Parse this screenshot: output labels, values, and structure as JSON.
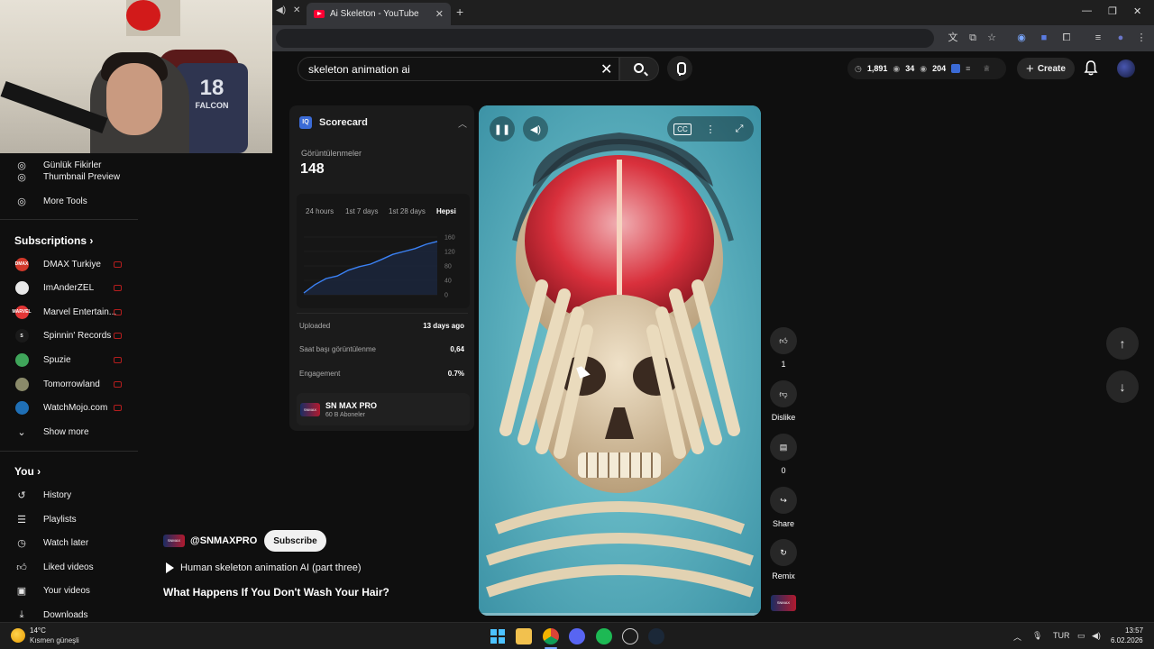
{
  "browser": {
    "tab_title": "Ai Skeleton - YouTube",
    "tab_close": "✕",
    "new_tab": "+"
  },
  "search": {
    "query": "skeleton animation ai"
  },
  "header_stats": {
    "stat1": "1,891",
    "stat2": "34",
    "stat3": "204"
  },
  "header": {
    "create_label": "Create"
  },
  "webcam": {
    "jersey_number": "18",
    "jersey_text": "FALCON"
  },
  "sidebar": {
    "top_items": [
      {
        "label": "Günlük Fikirler"
      },
      {
        "label": "Thumbnail Preview"
      },
      {
        "label": "More Tools"
      }
    ],
    "subscriptions_title": "Subscriptions",
    "subscriptions": [
      {
        "label": "DMAX Turkiye",
        "avatar_text": "DMAX",
        "avatar_color": "#d1382a"
      },
      {
        "label": "ImAnderZEL",
        "avatar_text": "",
        "avatar_color": "#e8e8e8"
      },
      {
        "label": "Marvel Entertain...",
        "avatar_text": "MARVEL",
        "avatar_color": "#e23636"
      },
      {
        "label": "Spinnin' Records",
        "avatar_text": "S",
        "avatar_color": "#1a1a1a"
      },
      {
        "label": "Spuzie",
        "avatar_text": "",
        "avatar_color": "#3fa55a"
      },
      {
        "label": "Tomorrowland",
        "avatar_text": "",
        "avatar_color": "#8a8a6a"
      },
      {
        "label": "WatchMojo.com",
        "avatar_text": "",
        "avatar_color": "#1f6fb5"
      }
    ],
    "show_more": "Show more",
    "you_title": "You",
    "you_items": [
      {
        "label": "History"
      },
      {
        "label": "Playlists"
      },
      {
        "label": "Watch later"
      },
      {
        "label": "Liked videos"
      },
      {
        "label": "Your videos"
      },
      {
        "label": "Downloads"
      }
    ]
  },
  "scorecard": {
    "title": "Scorecard",
    "metric_label": "Görüntülenmeler",
    "metric_value": "148",
    "tabs": [
      "24 hours",
      "1st 7 days",
      "1st 28 days",
      "Hepsi"
    ],
    "active_tab": "Hepsi",
    "chart_ticks": [
      "160",
      "120",
      "80",
      "40",
      "0"
    ],
    "rows": [
      {
        "label": "Uploaded",
        "value": "13 days ago"
      },
      {
        "label": "Saat başı görüntülenme",
        "value": "0,64"
      },
      {
        "label": "Engagement",
        "value": "0.7%"
      }
    ],
    "channel_name": "SN MAX PRO",
    "channel_subs": "60 B Aboneler",
    "chart_data": {
      "type": "area",
      "x": [
        0,
        1,
        2,
        3,
        4,
        5,
        6,
        7,
        8,
        9,
        10,
        11,
        12
      ],
      "values": [
        5,
        28,
        45,
        52,
        68,
        78,
        85,
        98,
        112,
        120,
        128,
        140,
        148
      ],
      "ylim": [
        0,
        160
      ],
      "yticks": [
        0,
        40,
        80,
        120,
        160
      ]
    }
  },
  "actions": {
    "like_count": "1",
    "dislike_label": "Dislike",
    "comment_count": "0",
    "share_label": "Share",
    "remix_label": "Remix"
  },
  "video": {
    "channel_handle": "@SNMAXPRO",
    "subscribe_label": "Subscribe",
    "playlist_label": "Human skeleton animation AI  (part three)",
    "title": "What Happens If You Don't Wash Your Hair?",
    "progress": 0.0
  },
  "taskbar": {
    "temperature": "14°C",
    "weather": "Kısmen güneşli",
    "language": "TUR",
    "time": "13:57",
    "date": "6.02.2026"
  }
}
